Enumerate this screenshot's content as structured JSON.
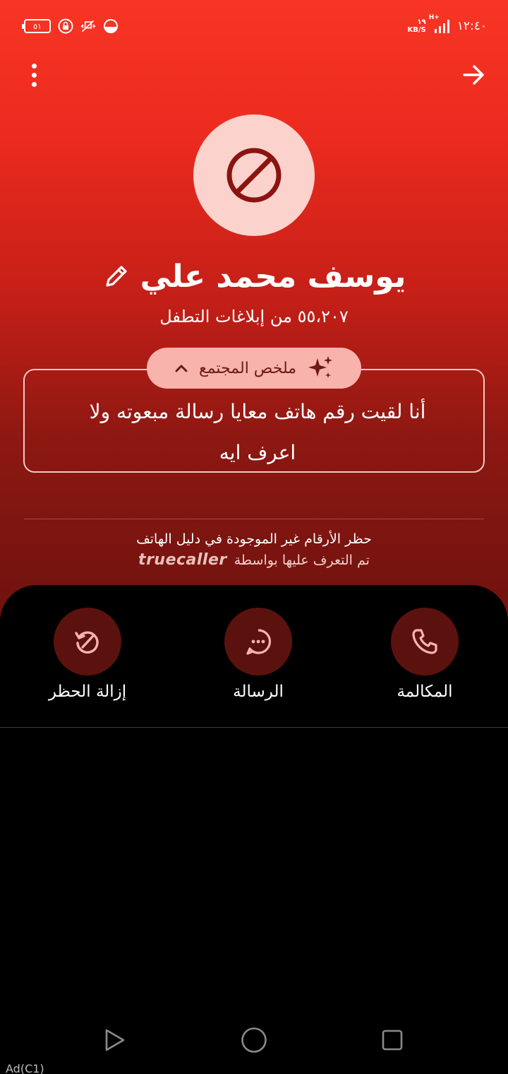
{
  "status_bar": {
    "battery": "٥١",
    "time": "١٢:٤٠",
    "net_speed_value": "١٩",
    "net_speed_unit": "KB/S",
    "signal": "H+"
  },
  "header": {
    "menu_icon": "more-vert-icon",
    "back_icon": "arrow-right-icon"
  },
  "caller": {
    "name": "يوسف محمد علي",
    "reports": "٥٥،٢٠٧ من إبلاغات التطفل",
    "avatar_icon": "block-icon"
  },
  "community": {
    "pill_label": "ملخص المجتمع",
    "summary": "أنا لقيت رقم هاتف معايا رسالة مبعوته ولا اعرف ايه"
  },
  "block_info": {
    "line1": "حظر الأرقام غير الموجودة في دليل الهاتف",
    "line2": "تم التعرف عليها بواسطة",
    "brand": "truecaller"
  },
  "actions": {
    "unblock": "إزالة الحظر",
    "message": "الرسالة",
    "call": "المكالمة"
  },
  "nav": {
    "ad_tag": "Ad(C1)"
  },
  "colors": {
    "accent": "#f83524",
    "action_bg": "#5b120e",
    "pill_bg": "#f7b3ac",
    "avatar_bg": "#fbd2cc"
  }
}
